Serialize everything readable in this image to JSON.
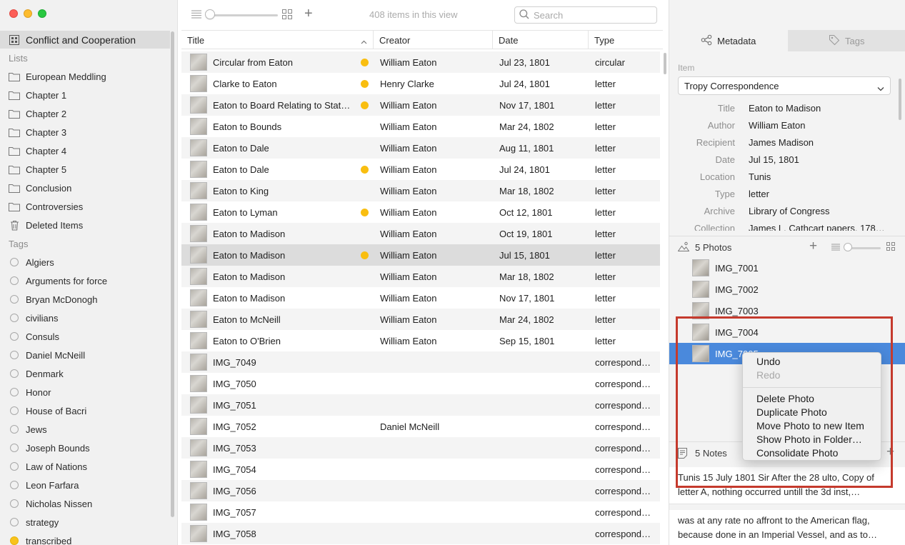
{
  "sidebar": {
    "project": "Conflict and Cooperation",
    "lists_heading": "Lists",
    "lists": [
      "European Meddling",
      "Chapter 1",
      "Chapter 2",
      "Chapter 3",
      "Chapter 4",
      "Chapter 5",
      "Conclusion",
      "Controversies",
      "Deleted Items"
    ],
    "tags_heading": "Tags",
    "tags": [
      "Algiers",
      "Arguments for force",
      "Bryan McDonogh",
      "civilians",
      "Consuls",
      "Daniel McNeill",
      "Denmark",
      "Honor",
      "House of Bacri",
      "Jews",
      "Joseph Bounds",
      "Law of Nations",
      "Leon Farfara",
      "Nicholas Nissen",
      "strategy",
      "transcribed"
    ]
  },
  "toolbar": {
    "count": "408 items in this view",
    "search_placeholder": "Search"
  },
  "table": {
    "columns": [
      "Title",
      "Creator",
      "Date",
      "Type"
    ],
    "rows": [
      {
        "title": "Circular from Eaton",
        "creator": "William Eaton",
        "date": "Jul 23, 1801",
        "type": "circular"
      },
      {
        "title": "Clarke to Eaton",
        "creator": "Henry Clarke",
        "date": "Jul 24, 1801",
        "type": "letter"
      },
      {
        "title": "Eaton to Board Relating to Stat…",
        "creator": "William Eaton",
        "date": "Nov 17, 1801",
        "type": "letter"
      },
      {
        "title": "Eaton to Bounds",
        "creator": "William Eaton",
        "date": "Mar 24, 1802",
        "type": "letter"
      },
      {
        "title": "Eaton to Dale",
        "creator": "William Eaton",
        "date": "Aug 11, 1801",
        "type": "letter"
      },
      {
        "title": "Eaton to Dale",
        "creator": "William Eaton",
        "date": "Jul 24, 1801",
        "type": "letter"
      },
      {
        "title": "Eaton to King",
        "creator": "William Eaton",
        "date": "Mar 18, 1802",
        "type": "letter"
      },
      {
        "title": "Eaton to Lyman",
        "creator": "William Eaton",
        "date": "Oct 12, 1801",
        "type": "letter"
      },
      {
        "title": "Eaton to Madison",
        "creator": "William Eaton",
        "date": "Oct 19, 1801",
        "type": "letter"
      },
      {
        "title": "Eaton to Madison",
        "creator": "William Eaton",
        "date": "Jul 15, 1801",
        "type": "letter"
      },
      {
        "title": "Eaton to Madison",
        "creator": "William Eaton",
        "date": "Mar 18, 1802",
        "type": "letter"
      },
      {
        "title": "Eaton to Madison",
        "creator": "William Eaton",
        "date": "Nov 17, 1801",
        "type": "letter"
      },
      {
        "title": "Eaton to McNeill",
        "creator": "William Eaton",
        "date": "Mar 24, 1802",
        "type": "letter"
      },
      {
        "title": "Eaton to O'Brien",
        "creator": "William Eaton",
        "date": "Sep 15, 1801",
        "type": "letter"
      },
      {
        "title": "IMG_7049",
        "creator": "",
        "date": "",
        "type": "correspond…"
      },
      {
        "title": "IMG_7050",
        "creator": "",
        "date": "",
        "type": "correspond…"
      },
      {
        "title": "IMG_7051",
        "creator": "",
        "date": "",
        "type": "correspond…"
      },
      {
        "title": "IMG_7052",
        "creator": "Daniel McNeill",
        "date": "",
        "type": "correspond…"
      },
      {
        "title": "IMG_7053",
        "creator": "",
        "date": "",
        "type": "correspond…"
      },
      {
        "title": "IMG_7054",
        "creator": "",
        "date": "",
        "type": "correspond…"
      },
      {
        "title": "IMG_7056",
        "creator": "",
        "date": "",
        "type": "correspond…"
      },
      {
        "title": "IMG_7057",
        "creator": "",
        "date": "",
        "type": "correspond…"
      },
      {
        "title": "IMG_7058",
        "creator": "",
        "date": "",
        "type": "correspond…"
      }
    ]
  },
  "panel": {
    "tab_metadata": "Metadata",
    "tab_tags": "Tags",
    "item_label": "Item",
    "template": "Tropy Correspondence",
    "fields": [
      {
        "key": "Title",
        "value": "Eaton to Madison"
      },
      {
        "key": "Author",
        "value": "William Eaton"
      },
      {
        "key": "Recipient",
        "value": "James Madison"
      },
      {
        "key": "Date",
        "value": "Jul 15, 1801"
      },
      {
        "key": "Location",
        "value": "Tunis"
      },
      {
        "key": "Type",
        "value": "letter"
      },
      {
        "key": "Archive",
        "value": "Library of Congress"
      },
      {
        "key": "Collection",
        "value": "James L. Cathcart papers, 178…"
      }
    ],
    "photos_title": "5 Photos",
    "photos": [
      "IMG_7001",
      "IMG_7002",
      "IMG_7003",
      "IMG_7004",
      "IMG_7005"
    ],
    "notes_title": "5 Notes",
    "notes": [
      "Tunis 15 July 1801 Sir After the 28 ulto, Copy of letter A, nothing occurred untill the 3d inst,…",
      "was at any rate no affront to the American flag, because done in an Imperial Vessel, and as to…"
    ]
  },
  "context_menu": {
    "undo": "Undo",
    "redo": "Redo",
    "delete": "Delete Photo",
    "duplicate": "Duplicate Photo",
    "move": "Move Photo to new Item",
    "show": "Show Photo in Folder…",
    "consolidate": "Consolidate Photo"
  },
  "colors": {
    "selection": "#4a89dc",
    "tag_yellow": "#f9be10",
    "highlight_box": "#c53a2d"
  }
}
